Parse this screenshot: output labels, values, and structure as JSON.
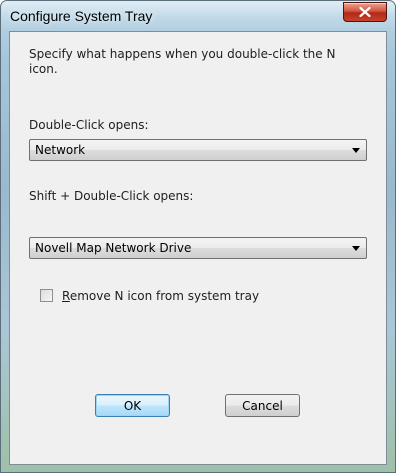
{
  "window": {
    "title": "Configure System Tray"
  },
  "dialog": {
    "description": "Specify what happens when you double-click the N icon.",
    "double_click_label": "Double-Click opens:",
    "double_click_value": "Network",
    "shift_double_click_label": "Shift + Double-Click opens:",
    "shift_double_click_value": "Novell Map Network Drive",
    "remove_icon_checkbox": {
      "accelerator": "R",
      "label_rest": "emove N icon from system tray",
      "checked": false
    },
    "ok_label": "OK",
    "cancel_label": "Cancel"
  },
  "icons": {
    "close": "close-icon",
    "dropdown": "chevron-down-icon"
  },
  "colors": {
    "close_button": "#c9422a",
    "default_button_border": "#3c7fb1"
  }
}
